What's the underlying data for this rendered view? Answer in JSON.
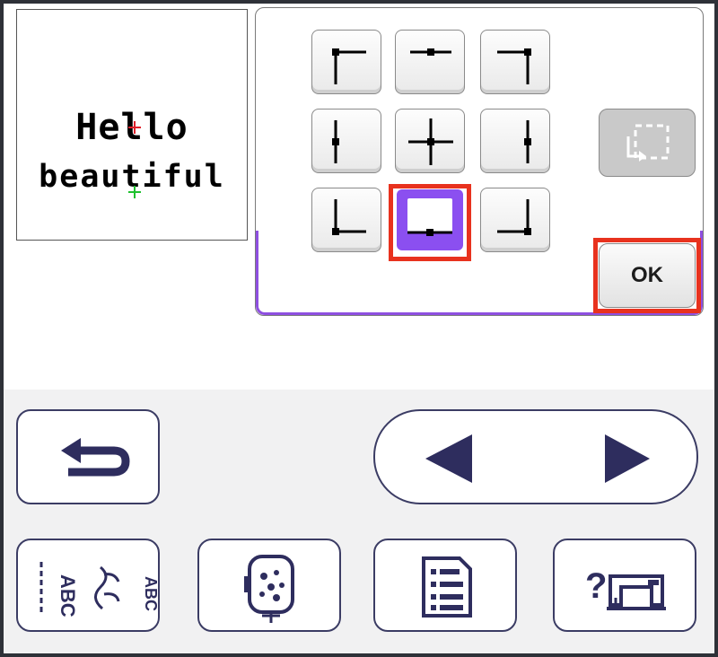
{
  "preview": {
    "line1": "Hello",
    "line2": "beautiful"
  },
  "position_grid": {
    "buttons": [
      "top-left",
      "top-center",
      "top-right",
      "middle-left",
      "center",
      "middle-right",
      "bottom-left",
      "bottom-center",
      "bottom-right"
    ],
    "selected": "bottom-center"
  },
  "dialog": {
    "ok_label": "OK"
  },
  "icons": {
    "rotate": "rotate-frame-icon",
    "back": "return-arrow-icon",
    "prev": "left-triangle-icon",
    "next": "right-triangle-icon",
    "embroidery": "embroidery-stitch-icon",
    "hoop": "embroidery-hoop-icon",
    "list": "document-list-icon",
    "help": "machine-help-icon"
  },
  "colors": {
    "accent": "#8b4ff0",
    "highlight": "#e8321e",
    "icon": "#2e2d5e"
  }
}
